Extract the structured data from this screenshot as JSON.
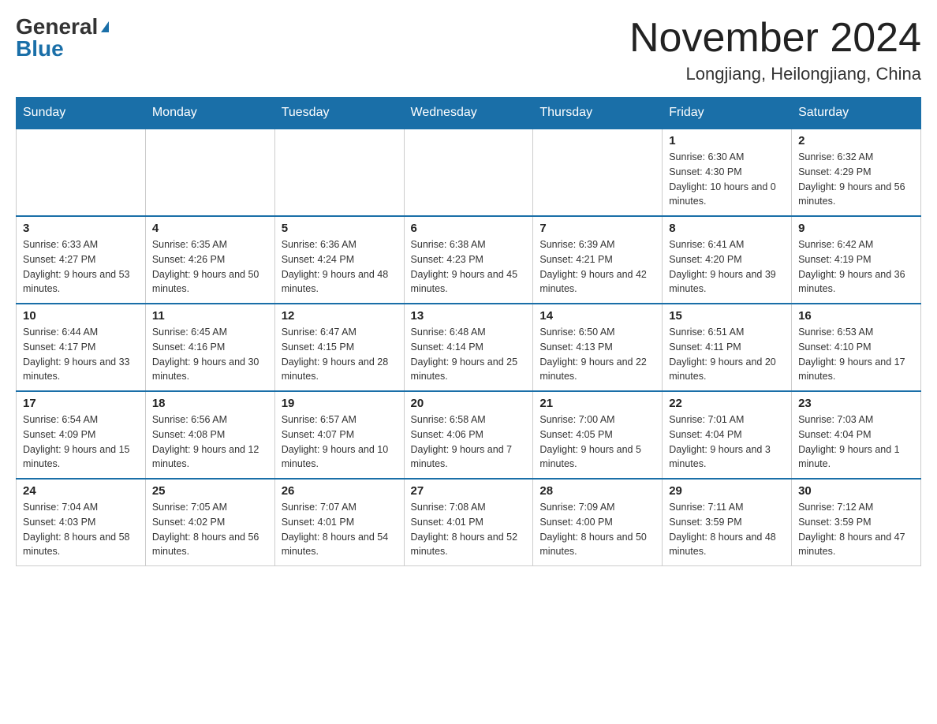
{
  "header": {
    "logo_general": "General",
    "logo_blue": "Blue",
    "month_title": "November 2024",
    "location": "Longjiang, Heilongjiang, China"
  },
  "weekdays": [
    "Sunday",
    "Monday",
    "Tuesday",
    "Wednesday",
    "Thursday",
    "Friday",
    "Saturday"
  ],
  "weeks": [
    [
      {
        "day": "",
        "info": ""
      },
      {
        "day": "",
        "info": ""
      },
      {
        "day": "",
        "info": ""
      },
      {
        "day": "",
        "info": ""
      },
      {
        "day": "",
        "info": ""
      },
      {
        "day": "1",
        "info": "Sunrise: 6:30 AM\nSunset: 4:30 PM\nDaylight: 10 hours and 0 minutes."
      },
      {
        "day": "2",
        "info": "Sunrise: 6:32 AM\nSunset: 4:29 PM\nDaylight: 9 hours and 56 minutes."
      }
    ],
    [
      {
        "day": "3",
        "info": "Sunrise: 6:33 AM\nSunset: 4:27 PM\nDaylight: 9 hours and 53 minutes."
      },
      {
        "day": "4",
        "info": "Sunrise: 6:35 AM\nSunset: 4:26 PM\nDaylight: 9 hours and 50 minutes."
      },
      {
        "day": "5",
        "info": "Sunrise: 6:36 AM\nSunset: 4:24 PM\nDaylight: 9 hours and 48 minutes."
      },
      {
        "day": "6",
        "info": "Sunrise: 6:38 AM\nSunset: 4:23 PM\nDaylight: 9 hours and 45 minutes."
      },
      {
        "day": "7",
        "info": "Sunrise: 6:39 AM\nSunset: 4:21 PM\nDaylight: 9 hours and 42 minutes."
      },
      {
        "day": "8",
        "info": "Sunrise: 6:41 AM\nSunset: 4:20 PM\nDaylight: 9 hours and 39 minutes."
      },
      {
        "day": "9",
        "info": "Sunrise: 6:42 AM\nSunset: 4:19 PM\nDaylight: 9 hours and 36 minutes."
      }
    ],
    [
      {
        "day": "10",
        "info": "Sunrise: 6:44 AM\nSunset: 4:17 PM\nDaylight: 9 hours and 33 minutes."
      },
      {
        "day": "11",
        "info": "Sunrise: 6:45 AM\nSunset: 4:16 PM\nDaylight: 9 hours and 30 minutes."
      },
      {
        "day": "12",
        "info": "Sunrise: 6:47 AM\nSunset: 4:15 PM\nDaylight: 9 hours and 28 minutes."
      },
      {
        "day": "13",
        "info": "Sunrise: 6:48 AM\nSunset: 4:14 PM\nDaylight: 9 hours and 25 minutes."
      },
      {
        "day": "14",
        "info": "Sunrise: 6:50 AM\nSunset: 4:13 PM\nDaylight: 9 hours and 22 minutes."
      },
      {
        "day": "15",
        "info": "Sunrise: 6:51 AM\nSunset: 4:11 PM\nDaylight: 9 hours and 20 minutes."
      },
      {
        "day": "16",
        "info": "Sunrise: 6:53 AM\nSunset: 4:10 PM\nDaylight: 9 hours and 17 minutes."
      }
    ],
    [
      {
        "day": "17",
        "info": "Sunrise: 6:54 AM\nSunset: 4:09 PM\nDaylight: 9 hours and 15 minutes."
      },
      {
        "day": "18",
        "info": "Sunrise: 6:56 AM\nSunset: 4:08 PM\nDaylight: 9 hours and 12 minutes."
      },
      {
        "day": "19",
        "info": "Sunrise: 6:57 AM\nSunset: 4:07 PM\nDaylight: 9 hours and 10 minutes."
      },
      {
        "day": "20",
        "info": "Sunrise: 6:58 AM\nSunset: 4:06 PM\nDaylight: 9 hours and 7 minutes."
      },
      {
        "day": "21",
        "info": "Sunrise: 7:00 AM\nSunset: 4:05 PM\nDaylight: 9 hours and 5 minutes."
      },
      {
        "day": "22",
        "info": "Sunrise: 7:01 AM\nSunset: 4:04 PM\nDaylight: 9 hours and 3 minutes."
      },
      {
        "day": "23",
        "info": "Sunrise: 7:03 AM\nSunset: 4:04 PM\nDaylight: 9 hours and 1 minute."
      }
    ],
    [
      {
        "day": "24",
        "info": "Sunrise: 7:04 AM\nSunset: 4:03 PM\nDaylight: 8 hours and 58 minutes."
      },
      {
        "day": "25",
        "info": "Sunrise: 7:05 AM\nSunset: 4:02 PM\nDaylight: 8 hours and 56 minutes."
      },
      {
        "day": "26",
        "info": "Sunrise: 7:07 AM\nSunset: 4:01 PM\nDaylight: 8 hours and 54 minutes."
      },
      {
        "day": "27",
        "info": "Sunrise: 7:08 AM\nSunset: 4:01 PM\nDaylight: 8 hours and 52 minutes."
      },
      {
        "day": "28",
        "info": "Sunrise: 7:09 AM\nSunset: 4:00 PM\nDaylight: 8 hours and 50 minutes."
      },
      {
        "day": "29",
        "info": "Sunrise: 7:11 AM\nSunset: 3:59 PM\nDaylight: 8 hours and 48 minutes."
      },
      {
        "day": "30",
        "info": "Sunrise: 7:12 AM\nSunset: 3:59 PM\nDaylight: 8 hours and 47 minutes."
      }
    ]
  ]
}
